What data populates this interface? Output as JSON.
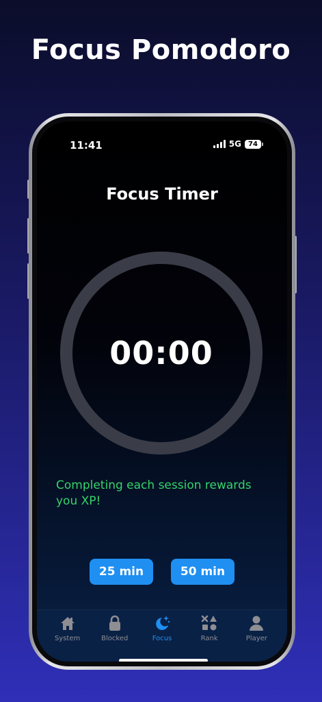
{
  "headline": "Focus Pomodoro",
  "status_bar": {
    "time": "11:41",
    "network": "5G",
    "battery": "74"
  },
  "screen": {
    "title": "Focus Timer",
    "timer": "00:00",
    "reward_message": "Completing each session rewards you XP!",
    "presets": [
      {
        "label": "25 min"
      },
      {
        "label": "50 min"
      }
    ]
  },
  "tabs": [
    {
      "label": "System",
      "icon": "house-icon"
    },
    {
      "label": "Blocked",
      "icon": "lock-icon"
    },
    {
      "label": "Focus",
      "icon": "moon-stars-icon",
      "active": true
    },
    {
      "label": "Rank",
      "icon": "shapes-icon"
    },
    {
      "label": "Player",
      "icon": "person-icon"
    }
  ],
  "colors": {
    "accent": "#1f8ff2",
    "reward_text": "#35d46a",
    "ring": "#3a3d48",
    "inactive_tab": "#8e8e93"
  }
}
